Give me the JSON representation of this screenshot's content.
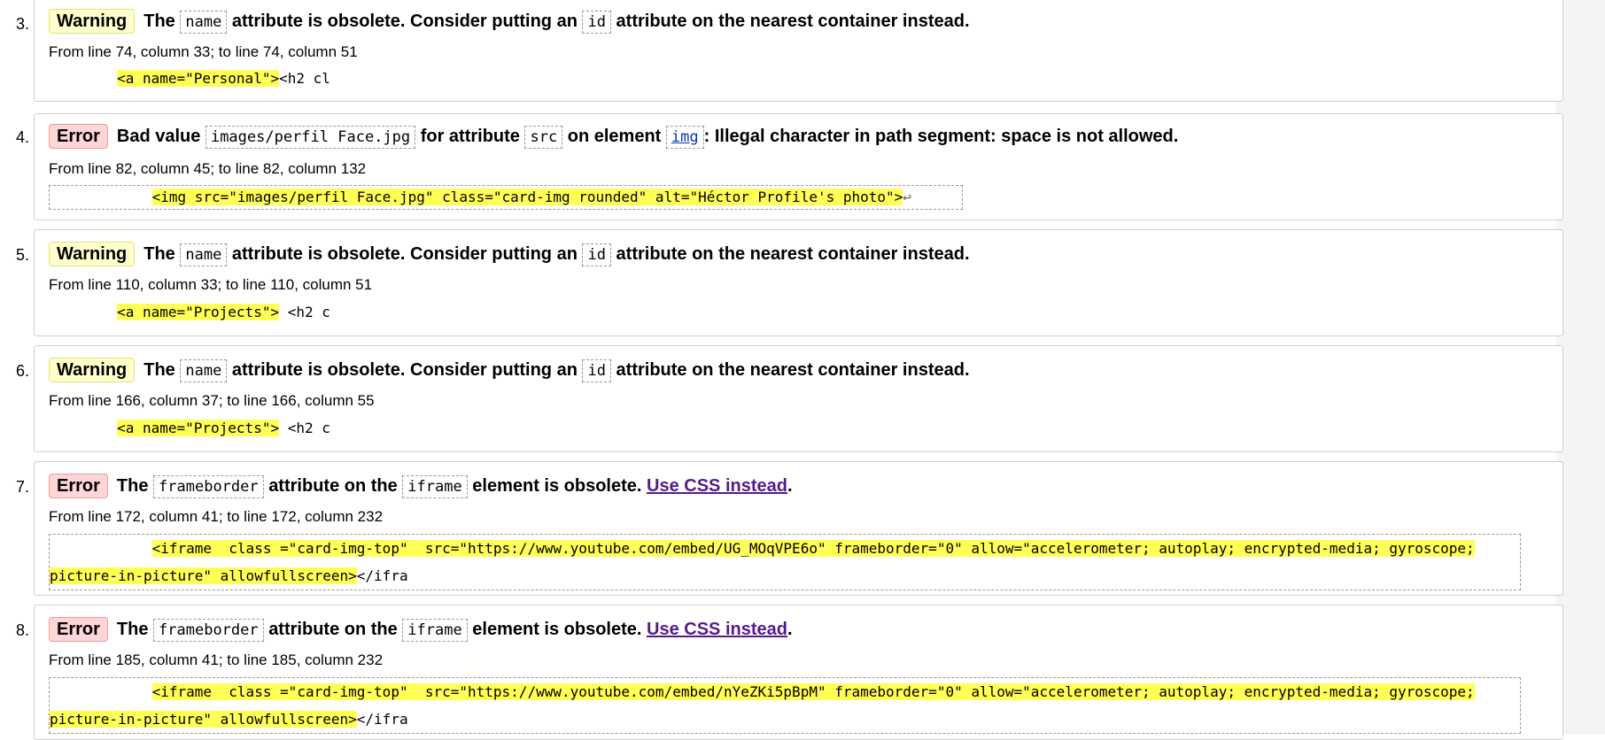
{
  "results": [
    {
      "num": "3.",
      "type": "Warning",
      "m": [
        "The",
        "name",
        "attribute is obsolete. Consider putting an",
        "id",
        "attribute on the nearest container instead."
      ],
      "location": "From line 74, column 33; to line 74, column 51",
      "extract_pre": "        ",
      "extract_hl": "<a name=\"Personal\">",
      "extract_post": "<h2 cl"
    },
    {
      "num": "4.",
      "type": "Error",
      "m": [
        "Bad value",
        "images/perfil Face.jpg",
        "for attribute",
        "src",
        "on element",
        "img",
        ": Illegal character in path segment: space is not allowed."
      ],
      "location": "From line 82, column 45; to line 82, column 132",
      "extract_pre": "            ",
      "extract_hl": "<img src=\"images/perfil Face.jpg\" class=\"card-img rounded\" alt=\"Héctor Profile's photo\">",
      "extract_post": "↩"
    },
    {
      "num": "5.",
      "type": "Warning",
      "m": [
        "The",
        "name",
        "attribute is obsolete. Consider putting an",
        "id",
        "attribute on the nearest container instead."
      ],
      "location": "From line 110, column 33; to line 110, column 51",
      "extract_pre": "        ",
      "extract_hl": "<a name=\"Projects\">",
      "extract_post": " <h2 c"
    },
    {
      "num": "6.",
      "type": "Warning",
      "m": [
        "The",
        "name",
        "attribute is obsolete. Consider putting an",
        "id",
        "attribute on the nearest container instead."
      ],
      "location": "From line 166, column 37; to line 166, column 55",
      "extract_pre": "        ",
      "extract_hl": "<a name=\"Projects\">",
      "extract_post": " <h2 c"
    },
    {
      "num": "7.",
      "type": "Error",
      "m": [
        "The",
        "frameborder",
        "attribute on the",
        "iframe",
        "element is obsolete.",
        "Use CSS instead",
        "."
      ],
      "location": "From line 172, column 41; to line 172, column 232",
      "extract_pre": "            ",
      "extract_hl": "<iframe  class =\"card-img-top\"  src=\"https://www.youtube.com/embed/UG_MOqVPE6o\" frameborder=\"0\" allow=\"accelerometer; autoplay; encrypted-media; gyroscope;",
      "extract_hl2": "picture-in-picture\" allowfullscreen>",
      "extract_post": "</ifra"
    },
    {
      "num": "8.",
      "type": "Error",
      "m": [
        "The",
        "frameborder",
        "attribute on the",
        "iframe",
        "element is obsolete.",
        "Use CSS instead",
        "."
      ],
      "location": "From line 185, column 41; to line 185, column 232",
      "extract_pre": "            ",
      "extract_hl": "<iframe  class =\"card-img-top\"  src=\"https://www.youtube.com/embed/nYeZKi5pBpM\" frameborder=\"0\" allow=\"accelerometer; autoplay; encrypted-media; gyroscope;",
      "extract_hl2": "picture-in-picture\" allowfullscreen>",
      "extract_post": "</ifra"
    }
  ],
  "colors": {
    "warning_bg": "#ffffcc",
    "error_bg": "#ffd6d6",
    "highlight": "#ffff55"
  }
}
